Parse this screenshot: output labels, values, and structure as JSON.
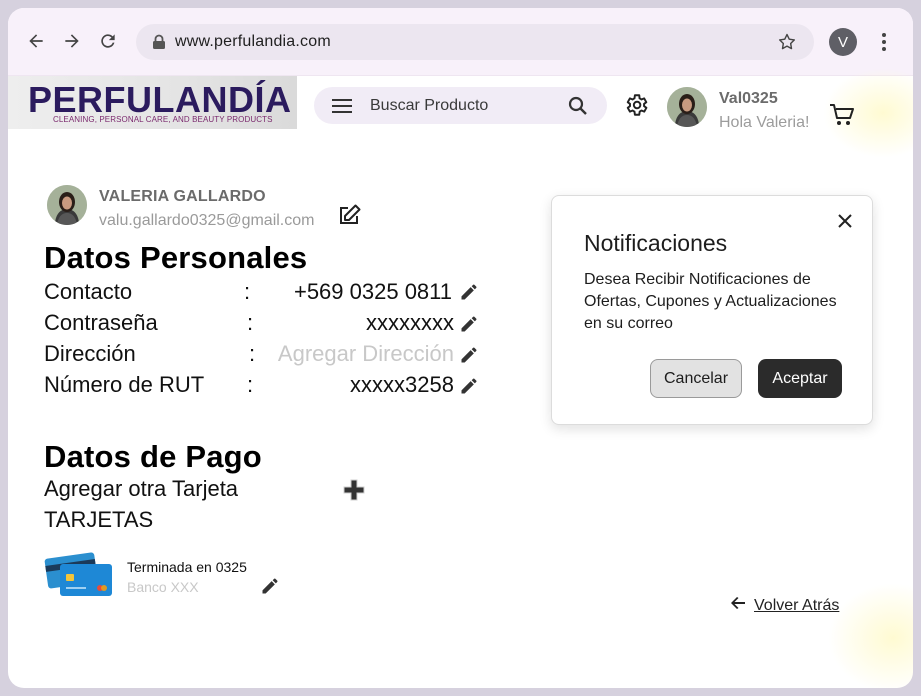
{
  "browser": {
    "url": "www.perfulandia.com",
    "profile_initial": "V"
  },
  "header": {
    "logo_title": "PERFULANDÍA",
    "logo_subtitle": "CLEANING, PERSONAL CARE, AND BEAUTY PRODUCTS",
    "search_placeholder": "Buscar Producto",
    "username": "Val0325",
    "greeting": "Hola Valeria!"
  },
  "profile": {
    "name": "VALERIA GALLARDO",
    "email": "valu.gallardo0325@gmail.com"
  },
  "personal": {
    "title": "Datos Personales",
    "rows": [
      {
        "label": "Contacto",
        "colon": ":",
        "value": "+569 0325 0811"
      },
      {
        "label": "Contraseña",
        "colon": ":",
        "value": "xxxxxxxx"
      },
      {
        "label": "Dirección",
        "colon": ":",
        "value": "Agregar Dirección"
      },
      {
        "label": "Número de RUT",
        "colon": ":",
        "value": "xxxxx3258"
      }
    ]
  },
  "payment": {
    "title": "Datos de Pago",
    "add_card": "Agregar otra Tarjeta",
    "cards_label": "TARJETAS",
    "card_ending": "Terminada en 0325",
    "card_bank": "Banco XXX"
  },
  "back_label": "Volver Atrás",
  "dialog": {
    "title": "Notificaciones",
    "body": "Desea Recibir Notificaciones de Ofertas, Cupones y Actualizaciones en su correo",
    "cancel": "Cancelar",
    "accept": "Aceptar"
  },
  "colors": {
    "brand": "#2b1b5e",
    "accent": "#7b2a6e",
    "accept_button": "#2b2b2b"
  }
}
